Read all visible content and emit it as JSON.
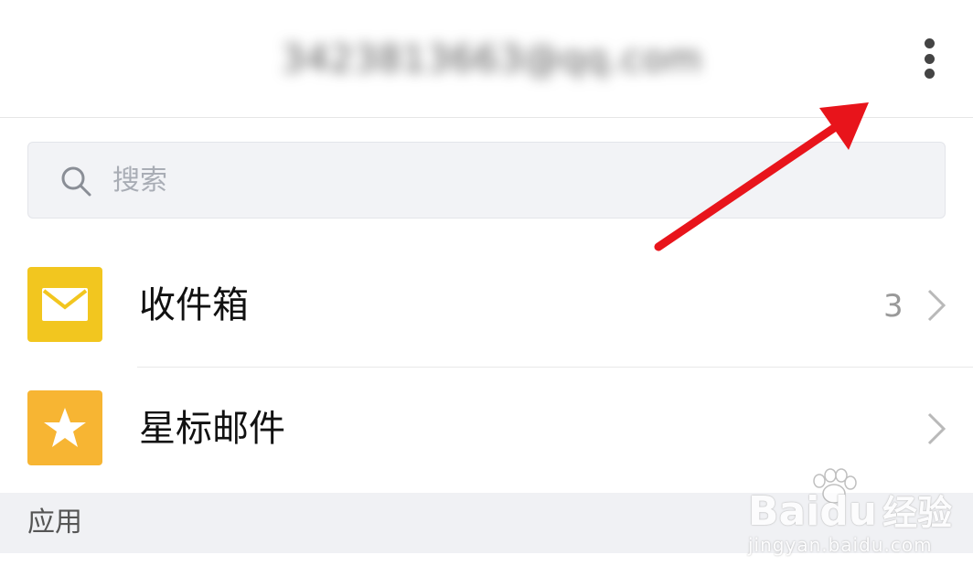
{
  "header": {
    "account_email": "3423813663@qq.com",
    "more_icon": "more-vertical-icon"
  },
  "search": {
    "placeholder": "搜索",
    "icon": "search-icon"
  },
  "folders": [
    {
      "label": "收件箱",
      "count": "3",
      "icon": "envelope-icon",
      "color": "#f2c61f"
    },
    {
      "label": "星标邮件",
      "count": "",
      "icon": "star-icon",
      "color": "#f7b533"
    }
  ],
  "section": {
    "label": "应用"
  },
  "annotation": {
    "arrow_color": "#e8141b"
  },
  "watermark": {
    "brand": "Baidu",
    "brand_suffix": "经验",
    "url": "jingyan.baidu.com"
  }
}
